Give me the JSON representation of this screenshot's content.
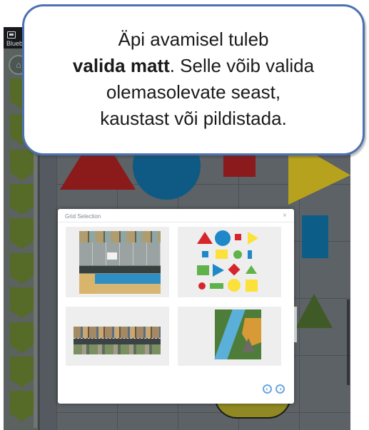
{
  "app": {
    "title": "Blueb",
    "icons": {
      "app": "app-window-icon",
      "home": "home-icon",
      "tool": "shield-tool-icon",
      "close": "close-icon",
      "scroll_up": "circle-arrow-icon",
      "scroll_down": "circle-arrow-icon"
    }
  },
  "dialog": {
    "title": "Grid Selection",
    "close_symbol": "×",
    "mats": [
      {
        "name": "city-mat"
      },
      {
        "name": "shapes-mat",
        "shape_colors": [
          "#d6262b",
          "#1e88c9",
          "#fbe13a",
          "#5fb34a"
        ]
      },
      {
        "name": "road-mat"
      },
      {
        "name": "map-mat"
      }
    ],
    "nav_symbols": {
      "prev": "◐",
      "next": "◑"
    }
  },
  "callout": {
    "line1": "Äpi avamisel tuleb",
    "line2_bold": "valida matt",
    "line2_rest": ". Selle võib valida",
    "line3": "olemasolevate seast,",
    "line4": "kaustast või pildistada."
  },
  "colors": {
    "callout_border": "#4d72b2",
    "sidebar_tool": "#566b28",
    "shape_red": "#8b1a1b",
    "shape_blue": "#0e5a84",
    "shape_yellow": "#b7a21e",
    "shape_green": "#3f5a26"
  }
}
